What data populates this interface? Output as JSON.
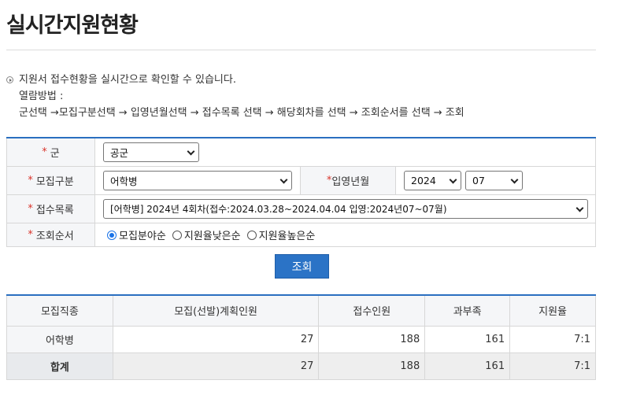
{
  "page": {
    "title": "실시간지원현황"
  },
  "info": {
    "lines": [
      "지원서 접수현황을 실시간으로 확인할 수 있습니다.",
      "열람방법 :",
      "군선택 →모집구분선택 → 입영년월선택 → 접수목록 선택 → 해당회차를 선택 → 조회순서를 선택 → 조회"
    ]
  },
  "form": {
    "required_mark": "*",
    "branch": {
      "label": "군",
      "value": "공군"
    },
    "category": {
      "label": "모집구분",
      "value": "어학병"
    },
    "enlist": {
      "label": "입영년월",
      "year": "2024",
      "month": "07"
    },
    "list": {
      "label": "접수목록",
      "value": "[어학병] 2024년 4회차(접수:2024.03.28~2024.04.04 입영:2024년07~07월)"
    },
    "order": {
      "label": "조회순서",
      "options": [
        "모집분야순",
        "지원율낮은순",
        "지원율높은순"
      ],
      "selected": 0
    },
    "submit_label": "조회"
  },
  "table": {
    "headers": [
      "모집직종",
      "모집(선발)계획인원",
      "접수인원",
      "과부족",
      "지원율"
    ],
    "rows": [
      {
        "type": "어학병",
        "planned": "27",
        "applied": "188",
        "diff": "161",
        "rate": "7:1"
      }
    ],
    "total": {
      "type": "합계",
      "planned": "27",
      "applied": "188",
      "diff": "161",
      "rate": "7:1"
    }
  }
}
